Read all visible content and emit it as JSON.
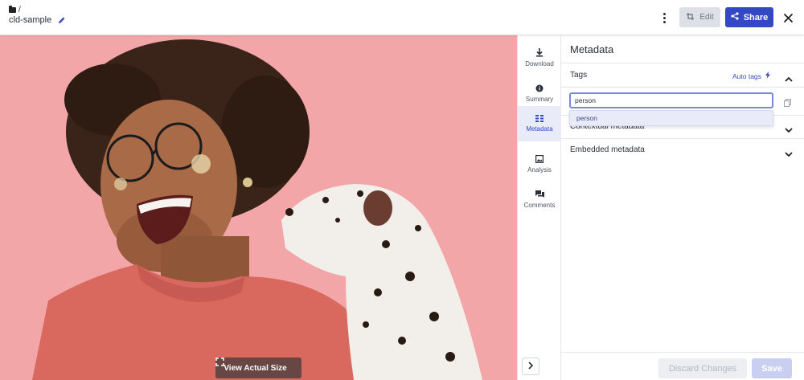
{
  "header": {
    "breadcrumb": "/",
    "asset_title": "cld-sample",
    "edit_label": "Edit",
    "share_label": "Share",
    "icons": [
      "folder-icon",
      "pencil-icon",
      "kebab-menu-icon",
      "edit-crop-icon",
      "share-icon",
      "close-icon"
    ],
    "share_color": "#3448c5"
  },
  "preview": {
    "view_actual_size_label": "View Actual Size",
    "background_color": "#f3a6a8"
  },
  "side_nav": {
    "items": [
      {
        "label": "Download",
        "icon": "download-icon"
      },
      {
        "label": "Summary",
        "icon": "info-icon"
      },
      {
        "label": "Metadata",
        "icon": "metadata-icon",
        "active": true
      },
      {
        "label": "Analysis",
        "icon": "image-analysis-icon"
      },
      {
        "label": "Comments",
        "icon": "comments-icon"
      }
    ]
  },
  "metadata": {
    "title": "Metadata",
    "tags_label": "Tags",
    "auto_tags_label": "Auto tags",
    "tag_input_value": "person",
    "suggestion": "person",
    "contextual_label": "Contextual metadata",
    "embedded_label": "Embedded metadata",
    "discard_label": "Discard Changes",
    "save_label": "Save"
  }
}
